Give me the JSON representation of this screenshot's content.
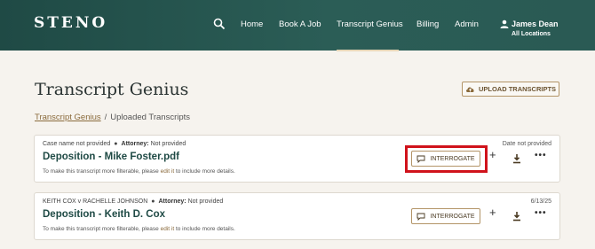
{
  "header": {
    "logo": "STENO",
    "nav": [
      {
        "label": "Home"
      },
      {
        "label": "Book A Job"
      },
      {
        "label": "Transcript Genius",
        "active": true
      },
      {
        "label": "Billing"
      },
      {
        "label": "Admin"
      }
    ],
    "user": {
      "name": "James Dean",
      "location": "All Locations"
    }
  },
  "page": {
    "title": "Transcript Genius",
    "upload_label": "UPLOAD TRANSCRIPTS",
    "breadcrumb": {
      "root": "Transcript Genius",
      "separator": "/",
      "current": "Uploaded Transcripts"
    }
  },
  "transcripts": [
    {
      "case": "Case name not provided",
      "attorney_label": "Attorney:",
      "attorney": "Not provided",
      "title": "Deposition - Mike Foster.pdf",
      "hint_before": "To make this transcript more filterable, please ",
      "hint_link": "edit it",
      "hint_after": " to include more details.",
      "date": "Date not provided",
      "interrogate_label": "INTERROGATE"
    },
    {
      "case": "KEITH COX v RACHELLE JOHNSON",
      "attorney_label": "Attorney:",
      "attorney": "Not provided",
      "title": "Deposition - Keith D. Cox",
      "hint_before": "To make this transcript more filterable, please ",
      "hint_link": "edit it",
      "hint_after": " to include more details.",
      "date": "6/13/25",
      "interrogate_label": "INTERROGATE"
    }
  ],
  "icons": {
    "search": "search-icon",
    "user": "user-icon",
    "upload": "cloud-upload-icon",
    "chat": "chat-bubble-icon",
    "plus": "+",
    "download": "download-icon",
    "more": "•••"
  },
  "colors": {
    "header_bg": "#2b5d56",
    "accent": "#b39467",
    "title_text": "#1f4a45",
    "highlight": "#d0121b"
  }
}
